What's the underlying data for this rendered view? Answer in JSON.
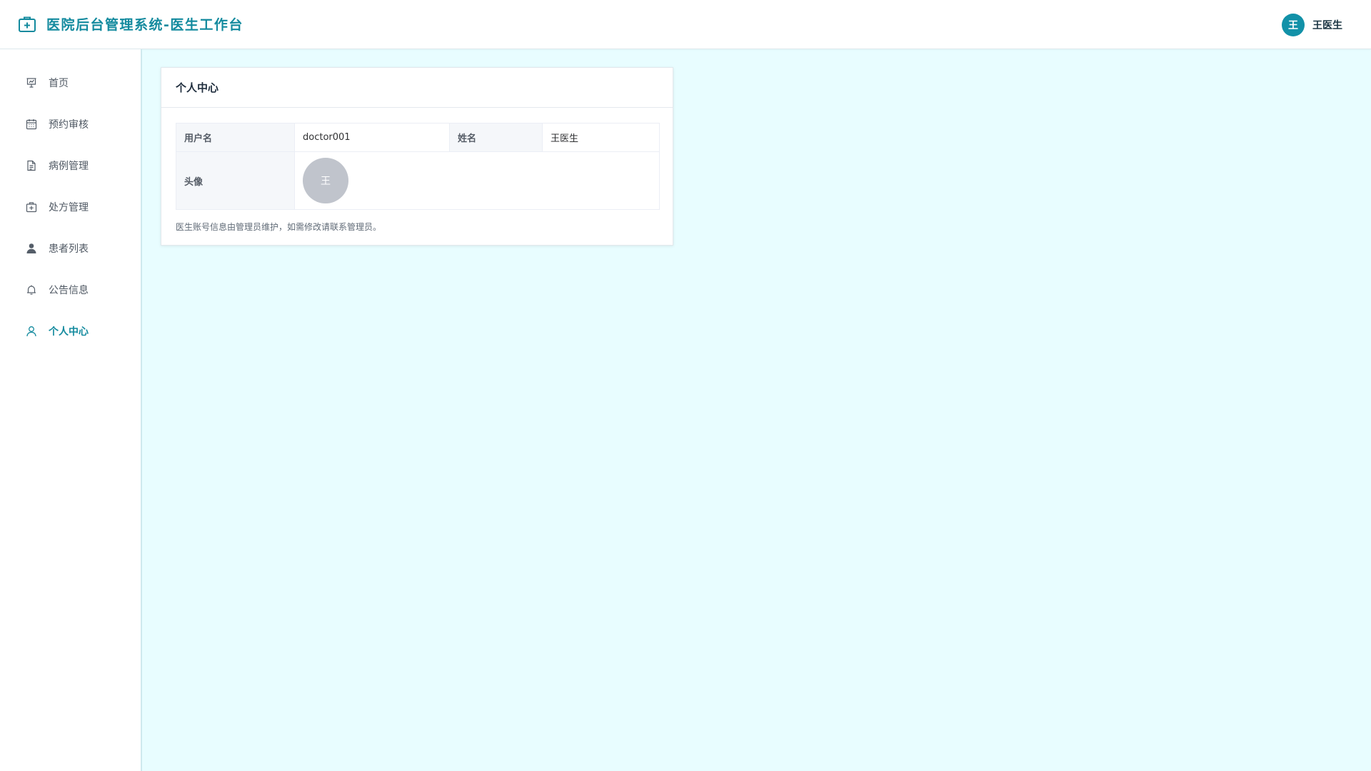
{
  "header": {
    "title": "医院后台管理系统-医生工作台",
    "brand_icon": "medical-kit-icon",
    "user": {
      "avatar_text": "王",
      "name": "王医生"
    }
  },
  "sidebar": {
    "items": [
      {
        "label": "首页",
        "icon": "presentation-chart-icon",
        "active": false
      },
      {
        "label": "预约审核",
        "icon": "calendar-icon",
        "active": false
      },
      {
        "label": "病例管理",
        "icon": "document-icon",
        "active": false
      },
      {
        "label": "处方管理",
        "icon": "first-aid-icon",
        "active": false
      },
      {
        "label": "患者列表",
        "icon": "user-filled-icon",
        "active": false
      },
      {
        "label": "公告信息",
        "icon": "bell-icon",
        "active": false
      },
      {
        "label": "个人中心",
        "icon": "user-outline-icon",
        "active": true
      }
    ]
  },
  "profile": {
    "title": "个人中心",
    "fields": {
      "username_label": "用户名",
      "username_value": "doctor001",
      "name_label": "姓名",
      "name_value": "王医生",
      "avatar_label": "头像",
      "avatar_text": "王"
    },
    "note": "医生账号信息由管理员维护，如需修改请联系管理员。"
  },
  "colors": {
    "accent": "#138a9e",
    "avatar_bg": "#1291a8",
    "main_bg": "#e8fdff",
    "profile_avatar_bg": "#c0c4cc"
  }
}
